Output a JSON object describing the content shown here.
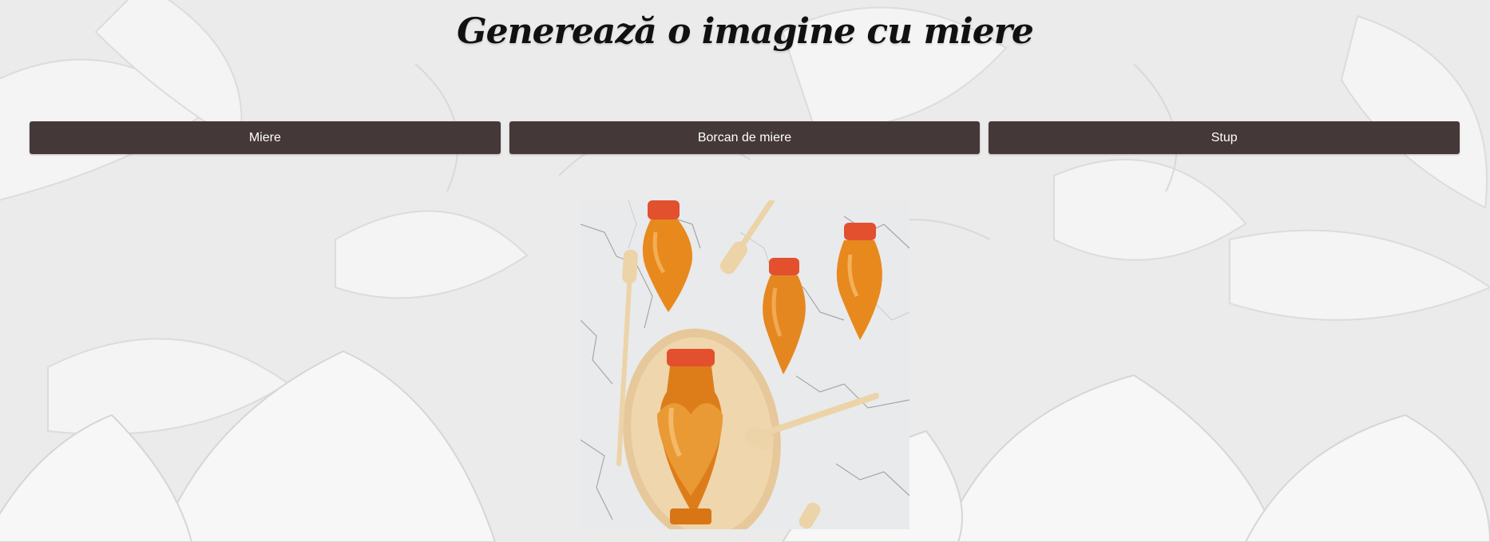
{
  "page": {
    "title": "Generează o imagine cu miere"
  },
  "buttons": [
    {
      "label": "Miere"
    },
    {
      "label": "Borcan de miere"
    },
    {
      "label": "Stup"
    }
  ],
  "image": {
    "subject": "honey-jars-photo"
  },
  "colors": {
    "button_bg": "#453838",
    "button_text": "#ffffff",
    "page_bg": "#ebebeb",
    "honey": "#e8891e",
    "lid": "#e2502e",
    "wood": "#ecd2a8",
    "marble": "#e8e9ea"
  }
}
